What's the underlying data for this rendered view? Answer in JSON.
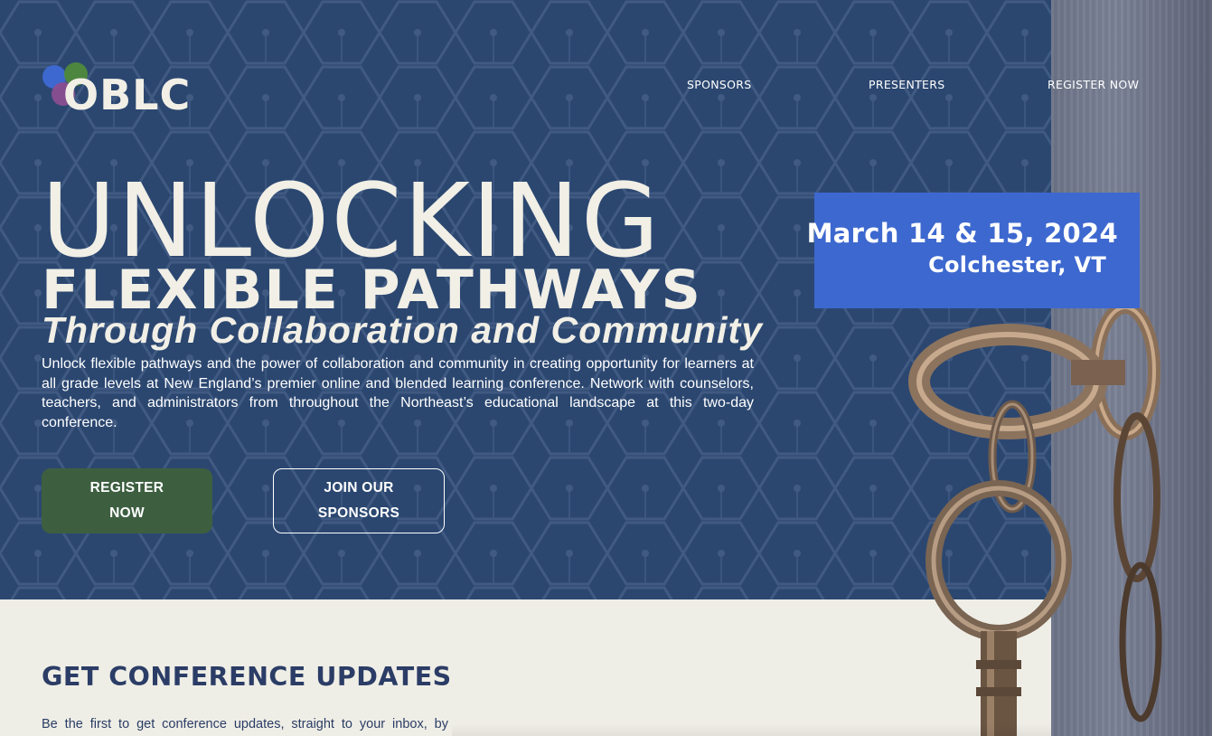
{
  "brand": {
    "logo_text": "OBLC"
  },
  "nav": {
    "sponsors": "SPONSORS",
    "presenters": "PRESENTERS",
    "register": "REGISTER NOW"
  },
  "hero": {
    "line1": "UNLOCKING",
    "line2": "FLEXIBLE PATHWAYS",
    "line3": "Through Collaboration and Community",
    "intro": "Unlock flexible pathways and the power of collaboration and community in creating opportunity for learners at all grade levels at New England’s premier online and blended learning conference. Network with counselors, teachers, and administrators from throughout the Northeast’s educational landscape at this two-day conference.",
    "register_button": "REGISTER NOW",
    "sponsor_button": "JOIN OUR SPONSORS"
  },
  "event": {
    "dates": "March 14 & 15, 2024",
    "location": "Colchester, VT"
  },
  "updates": {
    "title": "GET CONFERENCE UPDATES",
    "text": "Be the first to get conference updates, straight to your inbox, by"
  },
  "colors": {
    "hero_bg": "#2b4770",
    "cream": "#f1efe6",
    "date_box": "#3d68cf",
    "register_button": "#3d5f40",
    "heading_navy": "#2b3d66"
  },
  "icons": {
    "logo_mark": "three-overlapping-circles-icon",
    "keys_photo": "antique-keys-image"
  }
}
